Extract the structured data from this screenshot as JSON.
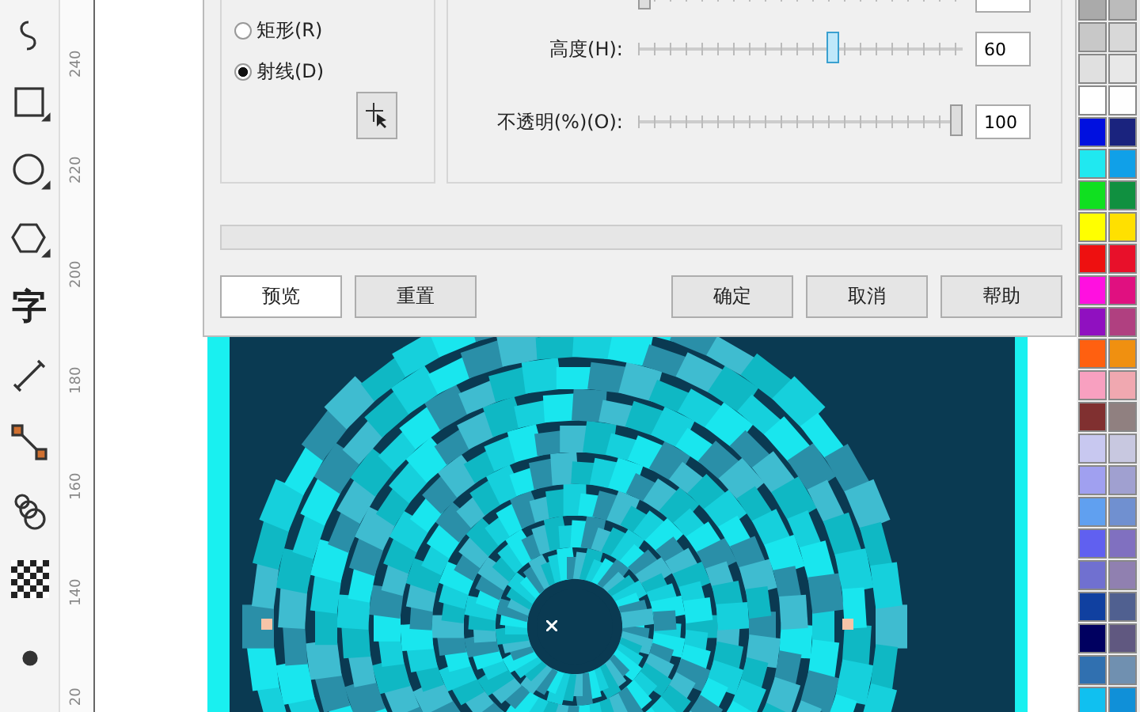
{
  "toolbar": {
    "tools": [
      {
        "kind": "curve"
      },
      {
        "kind": "rect"
      },
      {
        "kind": "ellipse"
      },
      {
        "kind": "polygon"
      },
      {
        "kind": "text",
        "label": "字"
      },
      {
        "kind": "dimension"
      },
      {
        "kind": "connector"
      },
      {
        "kind": "blend"
      },
      {
        "kind": "transparency"
      },
      {
        "kind": "fill"
      }
    ]
  },
  "ruler": {
    "ticks": [
      "240",
      "220",
      "200",
      "180",
      "160",
      "140",
      "20"
    ]
  },
  "dialog": {
    "type_group": {
      "options": [
        {
          "label": "矩形(R)",
          "selected": false
        },
        {
          "label": "射线(D)",
          "selected": true
        }
      ]
    },
    "sliders": [
      {
        "level": 0
      },
      {
        "label": "高度(H):",
        "level": 0.6,
        "value": "60"
      },
      {
        "label": "不透明(%)(O):",
        "level": 1,
        "value": "100"
      }
    ],
    "progress": {
      "level": 0
    },
    "buttons": [
      {
        "label": "预览",
        "default": true
      },
      {
        "label": "重置",
        "default": false
      },
      {
        "label": "确定",
        "default": false
      },
      {
        "label": "取消",
        "default": false
      },
      {
        "label": "帮助",
        "default": false
      }
    ]
  },
  "palette": {
    "swatches": [
      {
        "color": "#aaaaaa"
      },
      {
        "color": "#bbbbbb"
      },
      {
        "color": "#c8c8c8"
      },
      {
        "color": "#d8d8d8"
      },
      {
        "color": "#e0e0e0"
      },
      {
        "color": "#e8e8e8"
      },
      {
        "color": "#ffffff"
      },
      {
        "color": "#fefefe"
      },
      {
        "color": "#0010e0"
      },
      {
        "color": "#1a237e"
      },
      {
        "color": "#20e8f0"
      },
      {
        "color": "#10a0e8"
      },
      {
        "color": "#10e020"
      },
      {
        "color": "#109040"
      },
      {
        "color": "#ffff00"
      },
      {
        "color": "#ffe000"
      },
      {
        "color": "#ee1010"
      },
      {
        "color": "#e8102a"
      },
      {
        "color": "#ff10e0"
      },
      {
        "color": "#e01080"
      },
      {
        "color": "#9010c0"
      },
      {
        "color": "#b04080"
      },
      {
        "color": "#ff6010"
      },
      {
        "color": "#f09010"
      },
      {
        "color": "#f8a0c0"
      },
      {
        "color": "#f0a8b0"
      },
      {
        "color": "#803030"
      },
      {
        "color": "#908080"
      },
      {
        "color": "#c8c8f0"
      },
      {
        "color": "#c8c8e0"
      },
      {
        "color": "#a0a0f0"
      },
      {
        "color": "#a0a0d0"
      },
      {
        "color": "#60a0f0"
      },
      {
        "color": "#7090d0"
      },
      {
        "color": "#6060f0"
      },
      {
        "color": "#8070c0"
      },
      {
        "color": "#7070d0"
      },
      {
        "color": "#9080b0"
      },
      {
        "color": "#1040a0"
      },
      {
        "color": "#506090"
      },
      {
        "color": "#000060"
      },
      {
        "color": "#605880"
      },
      {
        "color": "#3070b0"
      },
      {
        "color": "#7090b0"
      },
      {
        "color": "#10c0f0"
      },
      {
        "color": "#1090d8"
      }
    ]
  }
}
